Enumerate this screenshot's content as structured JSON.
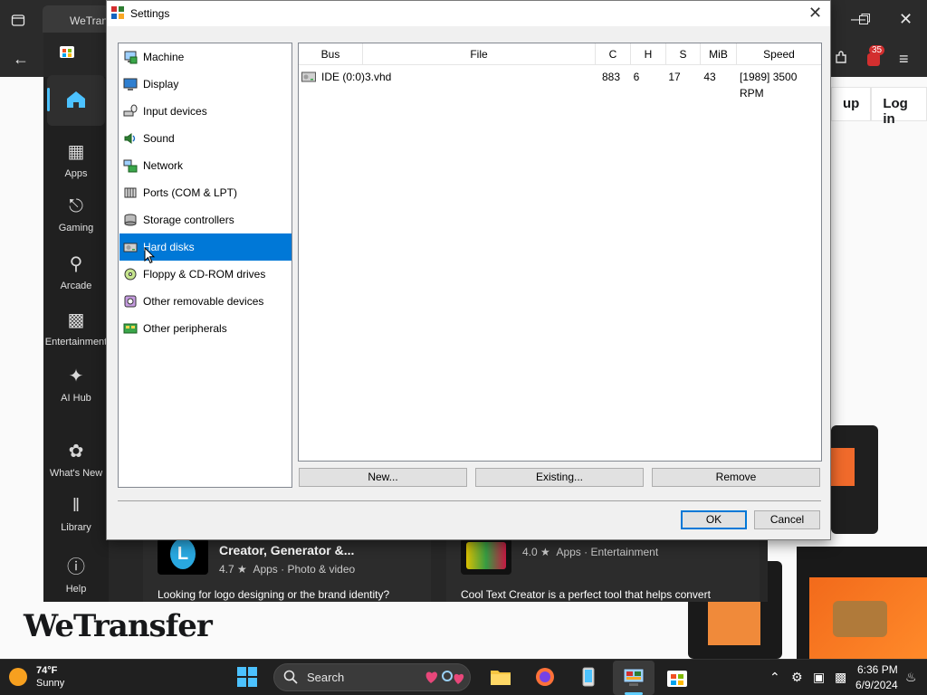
{
  "browser": {
    "tab_label": "WeTran",
    "badge_count": "35"
  },
  "wetransfer": {
    "signup_partial": "up",
    "login_label": "Log in",
    "logo_text": "WeTransfer"
  },
  "store": {
    "rail": [
      {
        "label": "",
        "icon": "home-icon"
      },
      {
        "label": "Apps",
        "icon": "apps-icon"
      },
      {
        "label": "Gaming",
        "icon": "gamepad-icon"
      },
      {
        "label": "Arcade",
        "icon": "joystick-icon"
      },
      {
        "label": "Entertainment",
        "icon": "clapperboard-icon"
      },
      {
        "label": "AI Hub",
        "icon": "sparkle-icon"
      },
      {
        "label": "What's New",
        "icon": "party-icon"
      },
      {
        "label": "Library",
        "icon": "library-icon"
      },
      {
        "label": "Help",
        "icon": "help-icon"
      }
    ],
    "cards": [
      {
        "title": "Creator, Generator &...",
        "rating": "4.7 ★",
        "category": "Apps  ·  Photo & video",
        "desc": "Looking for logo designing or the brand identity?"
      },
      {
        "rating": "4.0 ★",
        "category": "Apps  ·  Entertainment",
        "desc": "Cool Text Creator is a perfect tool that helps convert"
      }
    ]
  },
  "dialog": {
    "title": "Settings",
    "categories": [
      {
        "label": "Machine",
        "icon": "machine-icon"
      },
      {
        "label": "Display",
        "icon": "display-icon"
      },
      {
        "label": "Input devices",
        "icon": "input-devices-icon"
      },
      {
        "label": "Sound",
        "icon": "sound-icon"
      },
      {
        "label": "Network",
        "icon": "network-icon"
      },
      {
        "label": "Ports (COM & LPT)",
        "icon": "ports-icon"
      },
      {
        "label": "Storage controllers",
        "icon": "storage-icon"
      },
      {
        "label": "Hard disks",
        "icon": "hard-disk-icon",
        "selected": true
      },
      {
        "label": "Floppy & CD-ROM drives",
        "icon": "floppy-cdrom-icon"
      },
      {
        "label": "Other removable devices",
        "icon": "removable-icon"
      },
      {
        "label": "Other peripherals",
        "icon": "peripherals-icon"
      }
    ],
    "disk_table": {
      "columns": [
        "Bus",
        "File",
        "C",
        "H",
        "S",
        "MiB",
        "Speed"
      ],
      "rows": [
        {
          "bus": "IDE (0:0)",
          "file": "3.vhd",
          "c": "883",
          "h": "6",
          "s": "17",
          "mib": "43",
          "speed": "[1989] 3500 RPM"
        }
      ]
    },
    "buttons": {
      "new": "New...",
      "existing": "Existing...",
      "remove": "Remove",
      "ok": "OK",
      "cancel": "Cancel"
    }
  },
  "taskbar": {
    "temperature": "74°F",
    "condition": "Sunny",
    "search_label": "Search",
    "time": "6:36 PM",
    "date": "6/9/2024"
  },
  "colors": {
    "selection": "#0078d7",
    "accent": "#60cdff"
  }
}
